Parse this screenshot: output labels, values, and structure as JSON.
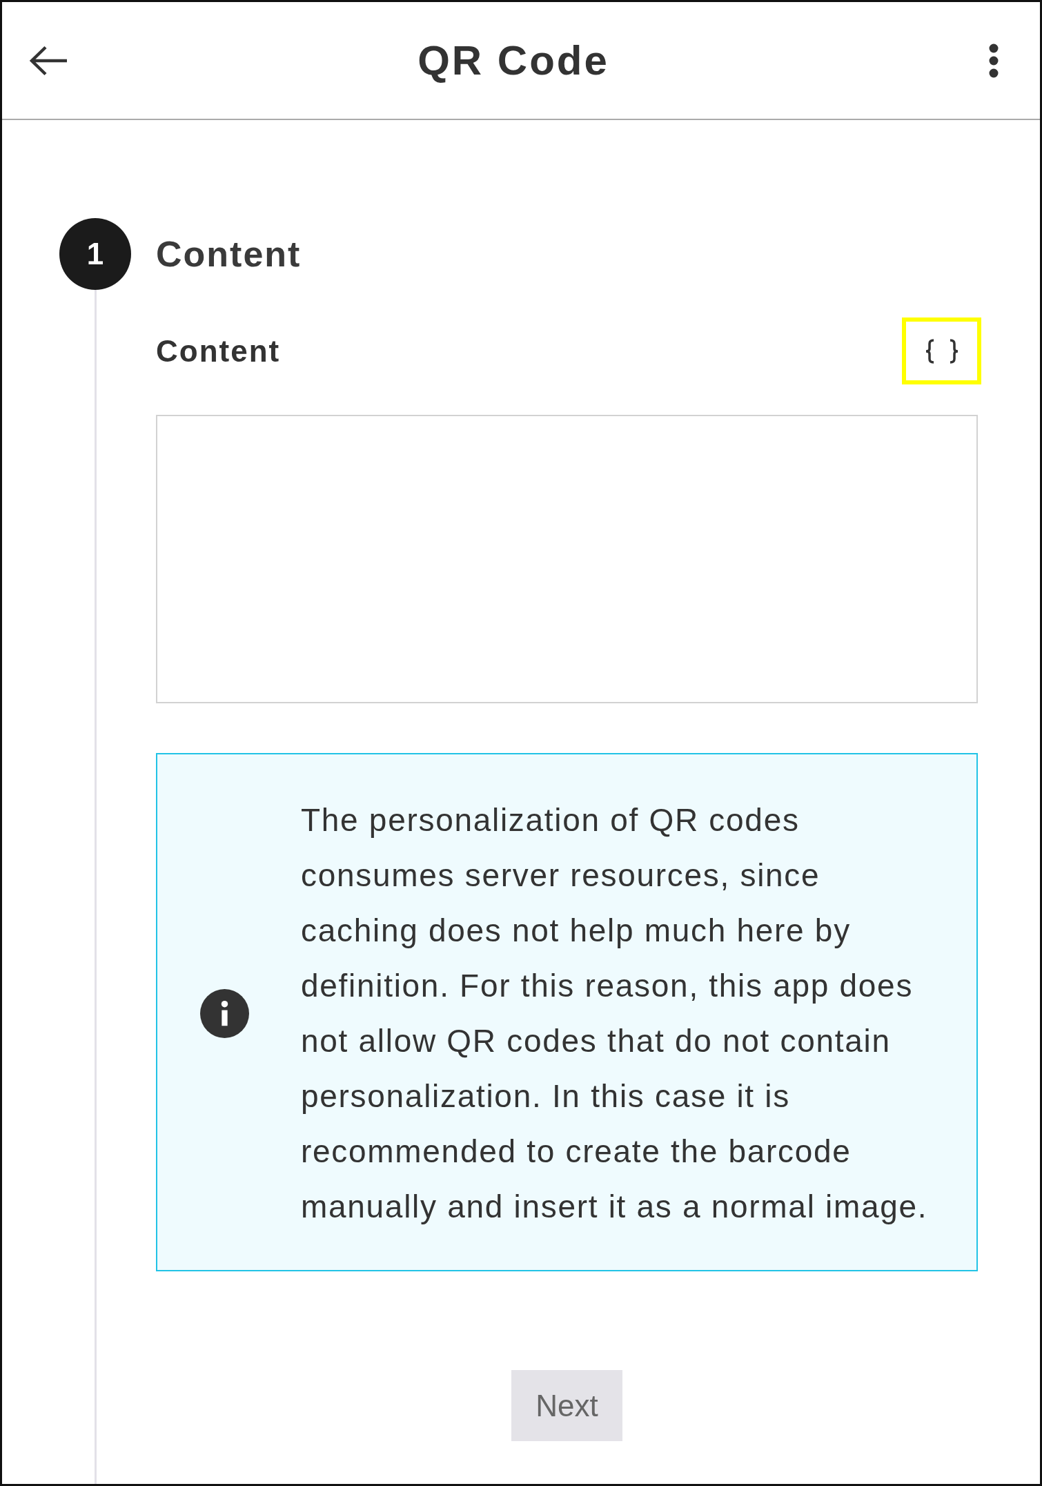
{
  "app_bar": {
    "title": "QR Code"
  },
  "steps": [
    {
      "number": "1",
      "title": "Content",
      "active": true,
      "field": {
        "label": "Content",
        "variable_button": {
          "highlighted": true
        }
      },
      "info": {
        "text": "The personalization of QR codes consumes server resources, since caching does not help much here by definition. For this reason, this app does not allow QR codes that do not contain personalization. In this case it is recommended to create the barcode manually and insert it as a normal image."
      },
      "next_button": {
        "label": "Next",
        "disabled": true
      }
    }
  ]
}
